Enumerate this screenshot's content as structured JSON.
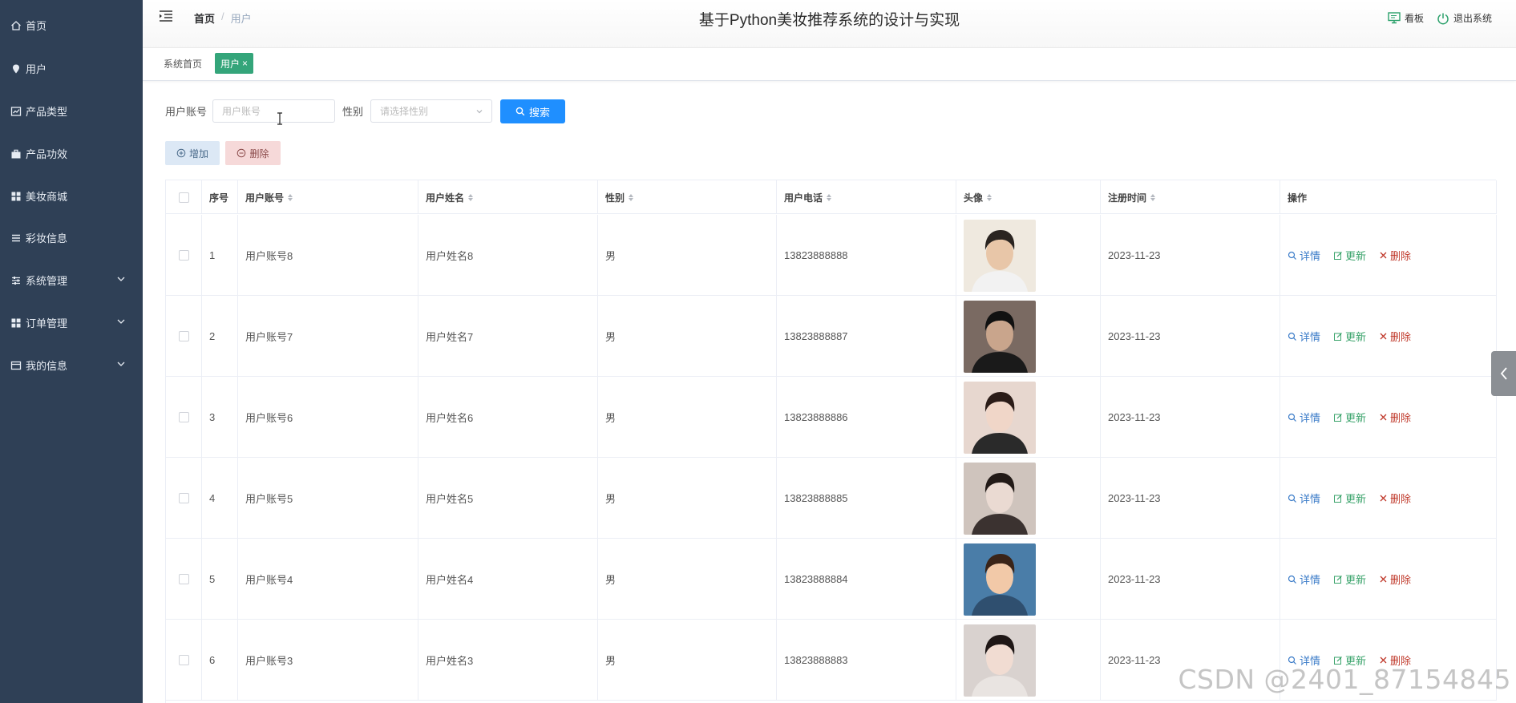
{
  "sidebar": {
    "items": [
      {
        "label": "首页",
        "icon": "home-icon"
      },
      {
        "label": "用户",
        "icon": "pin-icon"
      },
      {
        "label": "产品类型",
        "icon": "chart-icon"
      },
      {
        "label": "产品功效",
        "icon": "briefcase-icon"
      },
      {
        "label": "美妆商城",
        "icon": "grid-icon"
      },
      {
        "label": "彩妆信息",
        "icon": "list-icon"
      },
      {
        "label": "系统管理",
        "icon": "sliders-icon",
        "expandable": true
      },
      {
        "label": "订单管理",
        "icon": "grid-icon",
        "expandable": true
      },
      {
        "label": "我的信息",
        "icon": "card-icon",
        "expandable": true
      }
    ]
  },
  "header": {
    "breadcrumb": {
      "home": "首页",
      "separator": "/",
      "current": "用户"
    },
    "title": "基于Python美妆推荐系统的设计与实现",
    "actions": [
      {
        "label": "看板",
        "icon": "monitor-icon"
      },
      {
        "label": "退出系统",
        "icon": "power-icon"
      }
    ]
  },
  "tags": {
    "home": "系统首页",
    "active": "用户",
    "close": "×"
  },
  "search": {
    "account_label": "用户账号",
    "account_placeholder": "用户账号",
    "gender_label": "性别",
    "gender_placeholder": "请选择性别",
    "button": "搜索"
  },
  "toolbar": {
    "add": "增加",
    "delete": "删除"
  },
  "table": {
    "columns": [
      "序号",
      "用户账号",
      "用户姓名",
      "性别",
      "用户电话",
      "头像",
      "注册时间",
      "操作"
    ],
    "ops": {
      "detail": "详情",
      "update": "更新",
      "remove": "删除"
    },
    "rows": [
      {
        "no": "1",
        "account": "用户账号8",
        "name": "用户姓名8",
        "gender": "男",
        "phone": "13823888888",
        "date": "2023-11-23",
        "avatar": {
          "bg": "#efe9df",
          "skin": "#e8c6a8",
          "hair": "#2a2420",
          "top": "#f2f2f2"
        }
      },
      {
        "no": "2",
        "account": "用户账号7",
        "name": "用户姓名7",
        "gender": "男",
        "phone": "13823888887",
        "date": "2023-11-23",
        "avatar": {
          "bg": "#7a6a62",
          "skin": "#c9a58c",
          "hair": "#111111",
          "top": "#1a1a1a"
        }
      },
      {
        "no": "3",
        "account": "用户账号6",
        "name": "用户姓名6",
        "gender": "男",
        "phone": "13823888886",
        "date": "2023-11-23",
        "avatar": {
          "bg": "#e7d7cf",
          "skin": "#f0d6c8",
          "hair": "#2b1c18",
          "top": "#2a2a2a"
        }
      },
      {
        "no": "4",
        "account": "用户账号5",
        "name": "用户姓名5",
        "gender": "男",
        "phone": "13823888885",
        "date": "2023-11-23",
        "avatar": {
          "bg": "#cfc4bd",
          "skin": "#eadad2",
          "hair": "#221a17",
          "top": "#3b3230"
        }
      },
      {
        "no": "5",
        "account": "用户账号4",
        "name": "用户姓名4",
        "gender": "男",
        "phone": "13823888884",
        "date": "2023-11-23",
        "avatar": {
          "bg": "#4a7da8",
          "skin": "#f2c9a8",
          "hair": "#3a2418",
          "top": "#2f4f6f"
        }
      },
      {
        "no": "6",
        "account": "用户账号3",
        "name": "用户姓名3",
        "gender": "男",
        "phone": "13823888883",
        "date": "2023-11-23",
        "avatar": {
          "bg": "#d9d2cf",
          "skin": "#f1dcd2",
          "hair": "#1f1716",
          "top": "#e9e4e1"
        }
      }
    ]
  },
  "watermark": "CSDN @2401_87154845",
  "colors": {
    "sidebar": "#2f4056",
    "active_tag": "#34a57a",
    "primary": "#1f8fff"
  }
}
